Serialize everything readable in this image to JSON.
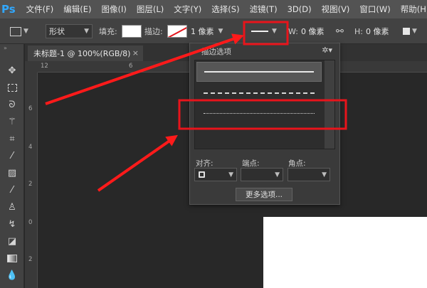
{
  "app": {
    "logo": "Ps",
    "brand_color": "#31a8ff"
  },
  "menu": [
    "文件(F)",
    "编辑(E)",
    "图像(I)",
    "图层(L)",
    "文字(Y)",
    "选择(S)",
    "滤镜(T)",
    "3D(D)",
    "视图(V)",
    "窗口(W)",
    "帮助(H)"
  ],
  "options": {
    "mode": "形状",
    "fill_label": "填充:",
    "stroke_label": "描边:",
    "stroke_width": "1 像素",
    "w_label": "W:",
    "w_value": "0 像素",
    "h_label": "H:",
    "h_value": "0 像素"
  },
  "document_tab": {
    "title": "未标题-1 @ 100%(RGB/8)",
    "close": "×"
  },
  "rulers": {
    "top": [
      "12",
      "6"
    ],
    "left": [
      "6",
      "4",
      "2",
      "0",
      "2"
    ]
  },
  "stroke_panel": {
    "title": "描边选项",
    "presets": [
      {
        "style": "solid"
      },
      {
        "style": "dashed"
      },
      {
        "style": "dotted",
        "selected": true
      }
    ],
    "align_label": "对齐:",
    "caps_label": "端点:",
    "corners_label": "角点:",
    "more_button": "更多选项..."
  },
  "colors": {
    "annotation": "#ff1a1a",
    "highlight_box": "#e8141b"
  }
}
